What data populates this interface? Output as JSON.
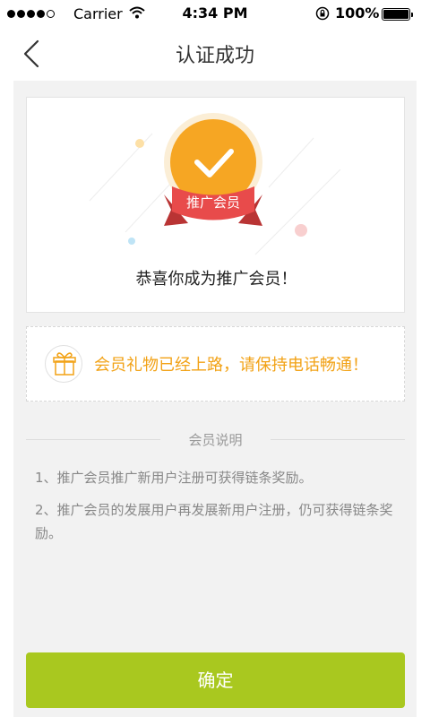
{
  "status_bar": {
    "carrier": "Carrier",
    "time": "4:34 PM",
    "battery": "100%"
  },
  "nav": {
    "title": "认证成功",
    "back_icon": "chevron-left-icon"
  },
  "success": {
    "badge_label": "推广会员",
    "message": "恭喜你成为推广会员！",
    "colors": {
      "badge": "#f6a623",
      "ribbon": "#e84b4b"
    }
  },
  "gift_notice": {
    "icon": "gift-icon",
    "text": "会员礼物已经上路，请保持电话畅通！",
    "color": "#f2a216"
  },
  "rules": {
    "title": "会员说明",
    "items": [
      "1、推广会员推广新用户注册可获得链条奖励。",
      "2、推广会员的发展用户再发展新用户注册，仍可获得链条奖励。"
    ]
  },
  "confirm_button": {
    "label": "确定",
    "color": "#a9c81f"
  }
}
